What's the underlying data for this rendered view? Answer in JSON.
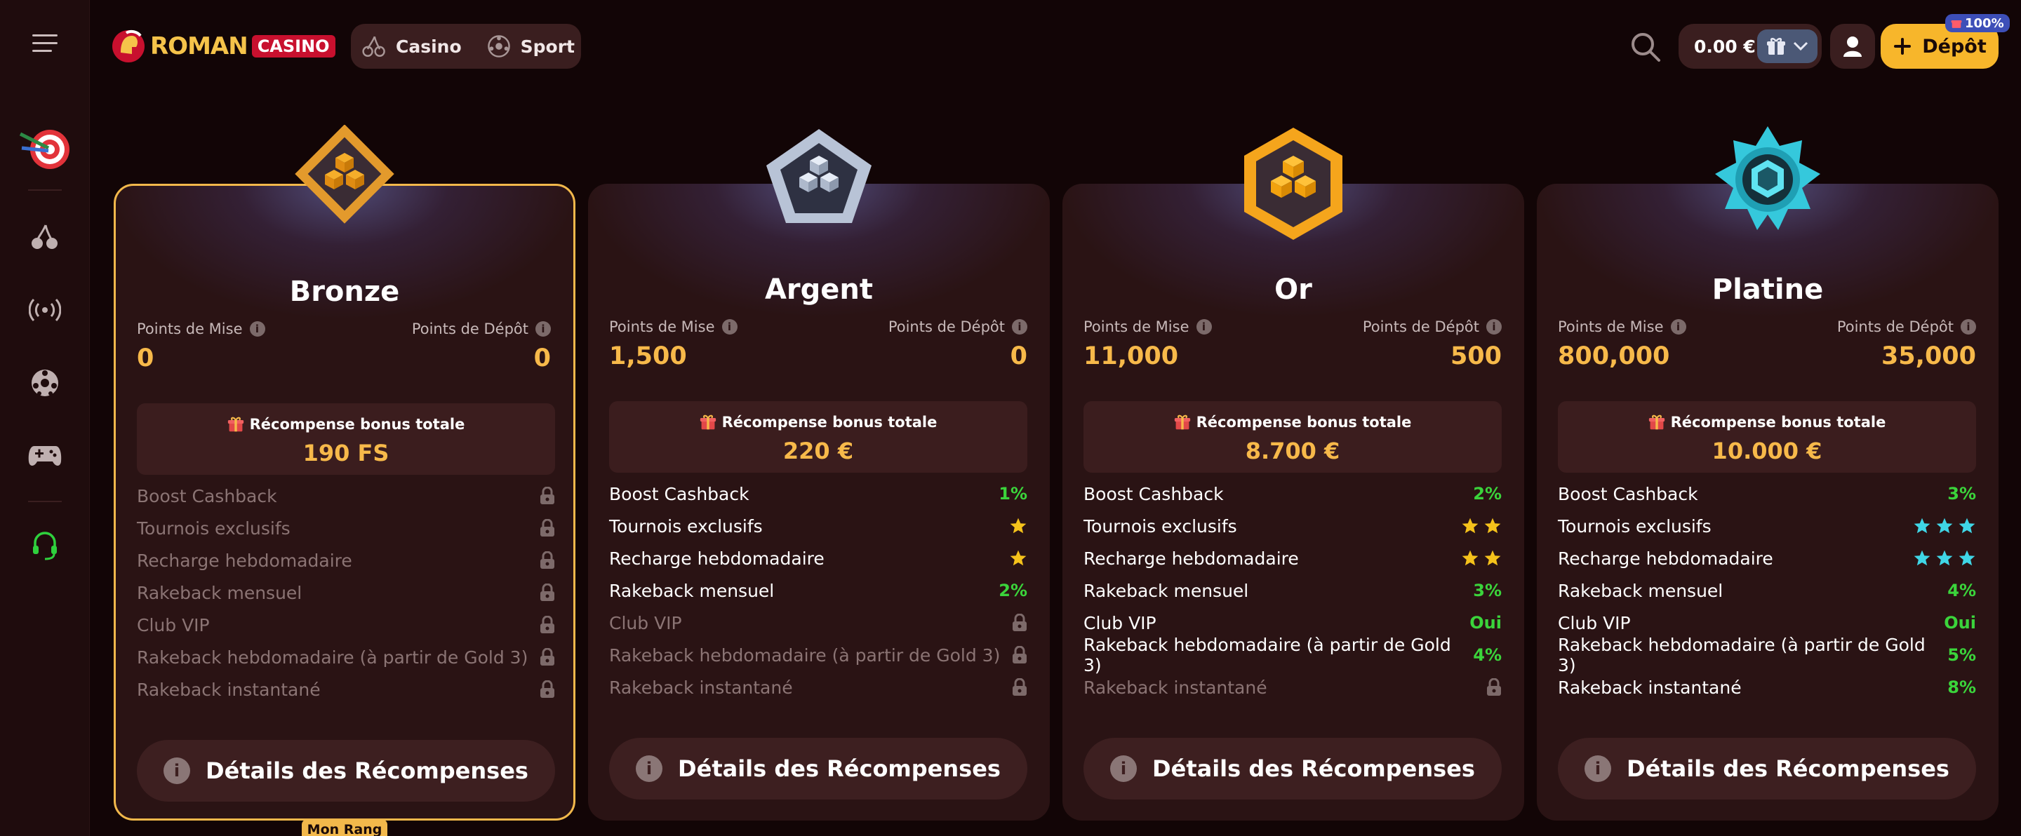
{
  "header": {
    "logo_roman": "ROMAN",
    "logo_casino": "CASINO",
    "nav": [
      {
        "label": "Casino",
        "icon": "cherry-icon"
      },
      {
        "label": "Sport",
        "icon": "soccer-ball-icon"
      }
    ],
    "balance": "0.00 €",
    "deposit_label": "Dépôt",
    "badge_pct": "100%"
  },
  "sidebar": {
    "items": [
      {
        "icon": "menu-icon"
      },
      {
        "icon": "darts-target-icon"
      },
      {
        "icon": "cherry-icon"
      },
      {
        "icon": "live-broadcast-icon"
      },
      {
        "icon": "soccer-ball-icon"
      },
      {
        "icon": "gamepad-icon"
      },
      {
        "icon": "headset-support-icon"
      }
    ]
  },
  "labels": {
    "bet_points": "Points de Mise",
    "deposit_points": "Points de Dépôt",
    "total_bonus": "Récompense bonus totale",
    "details": "Détails des Récompenses",
    "my_rank": "Mon Rang"
  },
  "tiers": [
    {
      "name": "Bronze",
      "bet_points": "0",
      "deposit_points": "0",
      "total_bonus": "190 FS",
      "perks": [
        {
          "name": "Boost Cashback",
          "value": "",
          "kind": "lock"
        },
        {
          "name": "Tournois exclusifs",
          "value": "",
          "kind": "lock"
        },
        {
          "name": "Recharge hebdomadaire",
          "value": "",
          "kind": "lock"
        },
        {
          "name": "Rakeback mensuel",
          "value": "",
          "kind": "lock"
        },
        {
          "name": "Club VIP",
          "value": "",
          "kind": "lock"
        },
        {
          "name": "Rakeback hebdomadaire (à partir de Gold 3)",
          "value": "",
          "kind": "lock"
        },
        {
          "name": "Rakeback instantané",
          "value": "",
          "kind": "lock"
        }
      ]
    },
    {
      "name": "Argent",
      "bet_points": "1,500",
      "deposit_points": "0",
      "total_bonus": "220 €",
      "perks": [
        {
          "name": "Boost Cashback",
          "value": "1%",
          "kind": "text"
        },
        {
          "name": "Tournois exclusifs",
          "value": "1",
          "kind": "stars"
        },
        {
          "name": "Recharge hebdomadaire",
          "value": "1",
          "kind": "stars"
        },
        {
          "name": "Rakeback mensuel",
          "value": "2%",
          "kind": "text"
        },
        {
          "name": "Club VIP",
          "value": "",
          "kind": "lock"
        },
        {
          "name": "Rakeback hebdomadaire (à partir de Gold 3)",
          "value": "",
          "kind": "lock"
        },
        {
          "name": "Rakeback instantané",
          "value": "",
          "kind": "lock"
        }
      ]
    },
    {
      "name": "Or",
      "bet_points": "11,000",
      "deposit_points": "500",
      "total_bonus": "8.700 €",
      "perks": [
        {
          "name": "Boost Cashback",
          "value": "2%",
          "kind": "text"
        },
        {
          "name": "Tournois exclusifs",
          "value": "2",
          "kind": "stars"
        },
        {
          "name": "Recharge hebdomadaire",
          "value": "2",
          "kind": "stars"
        },
        {
          "name": "Rakeback mensuel",
          "value": "3%",
          "kind": "text"
        },
        {
          "name": "Club VIP",
          "value": "Oui",
          "kind": "text"
        },
        {
          "name": "Rakeback hebdomadaire (à partir de Gold 3)",
          "value": "4%",
          "kind": "text"
        },
        {
          "name": "Rakeback instantané",
          "value": "",
          "kind": "lock"
        }
      ]
    },
    {
      "name": "Platine",
      "bet_points": "800,000",
      "deposit_points": "35,000",
      "total_bonus": "10.000 €",
      "perks": [
        {
          "name": "Boost Cashback",
          "value": "3%",
          "kind": "text"
        },
        {
          "name": "Tournois exclusifs",
          "value": "3",
          "kind": "stars"
        },
        {
          "name": "Recharge hebdomadaire",
          "value": "3",
          "kind": "stars"
        },
        {
          "name": "Rakeback mensuel",
          "value": "4%",
          "kind": "text"
        },
        {
          "name": "Club VIP",
          "value": "Oui",
          "kind": "text"
        },
        {
          "name": "Rakeback hebdomadaire (à partir de Gold 3)",
          "value": "5%",
          "kind": "text"
        },
        {
          "name": "Rakeback instantané",
          "value": "8%",
          "kind": "text"
        }
      ]
    }
  ],
  "colors": {
    "accent_gold": "#f7b94a",
    "success_green": "#3bd43b",
    "star_silver": "#cfcfd8",
    "star_gold": "#f5c21b",
    "star_cyan": "#3fd6e6"
  }
}
